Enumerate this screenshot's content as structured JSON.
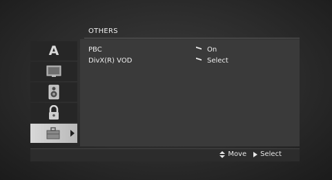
{
  "menu": {
    "title": "OTHERS",
    "items": [
      {
        "label": "PBC",
        "value": "On"
      },
      {
        "label": "DivX(R) VOD",
        "value": "Select"
      }
    ]
  },
  "tabs": [
    {
      "icon": "language-a-icon",
      "glyph": "A",
      "active": false
    },
    {
      "icon": "display-icon",
      "active": false
    },
    {
      "icon": "speaker-icon",
      "active": false
    },
    {
      "icon": "lock-icon",
      "active": false
    },
    {
      "icon": "others-toolbox-icon",
      "active": true
    }
  ],
  "footer": {
    "move_label": "Move",
    "select_label": "Select"
  },
  "colors": {
    "background": "#2b2b2b",
    "panel": "#3a3a3a",
    "active_tab": "#c8c8c8",
    "text": "#f0f0f0"
  }
}
